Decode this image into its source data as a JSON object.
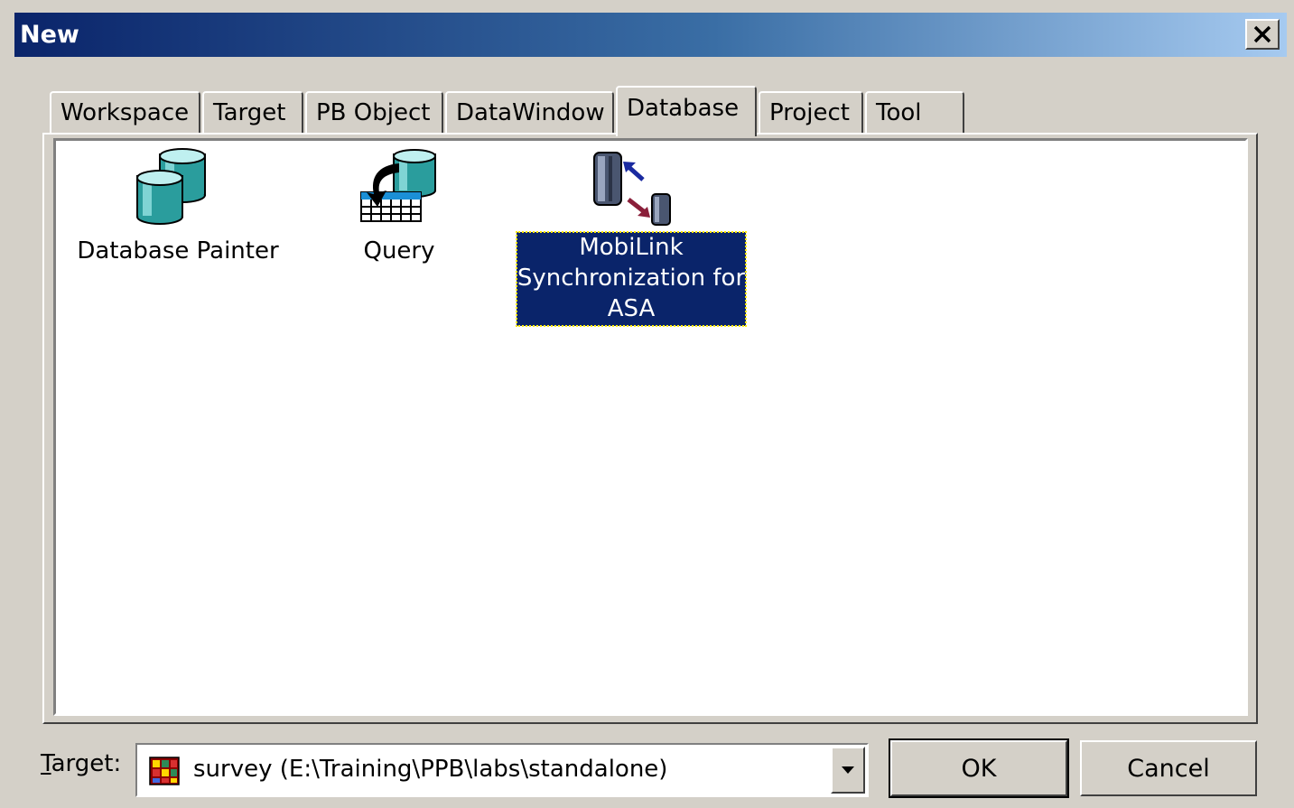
{
  "window": {
    "title": "New",
    "close_icon": "close-icon"
  },
  "tabs": [
    {
      "label": "Workspace",
      "active": false
    },
    {
      "label": "Target",
      "active": false
    },
    {
      "label": "PB Object",
      "active": false
    },
    {
      "label": "DataWindow",
      "active": false
    },
    {
      "label": "Database",
      "active": true
    },
    {
      "label": "Project",
      "active": false
    },
    {
      "label": "Tool",
      "active": false
    }
  ],
  "items": [
    {
      "label": "Database Painter",
      "icon": "database-painter-icon",
      "selected": false
    },
    {
      "label": "Query",
      "icon": "query-icon",
      "selected": false
    },
    {
      "label": "MobiLink Synchronization for ASA",
      "icon": "mobilink-sync-icon",
      "selected": true
    }
  ],
  "target": {
    "label_accel": "T",
    "label_rest": "arget:",
    "value": "survey (E:\\Training\\PPB\\labs\\standalone)",
    "icon": "target-app-icon"
  },
  "buttons": {
    "ok": "OK",
    "cancel": "Cancel"
  },
  "colors": {
    "selection": "#0a246a",
    "title_start": "#0a246a",
    "title_end": "#a6caf0",
    "dialog_face": "#d4d0c8"
  }
}
